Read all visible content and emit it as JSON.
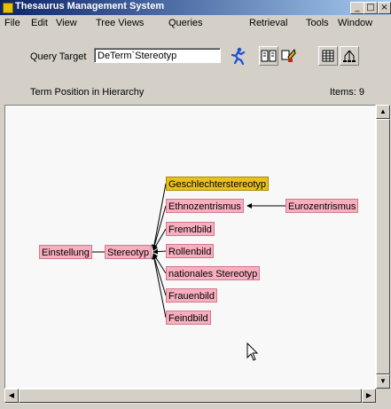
{
  "window": {
    "title": "Thesaurus Management System",
    "controls": [
      "_",
      "□",
      "×"
    ]
  },
  "menu": {
    "items": [
      {
        "label": "File"
      },
      {
        "label": "Edit"
      },
      {
        "label": "View"
      },
      {
        "label": "Tree Views"
      },
      {
        "label": "Queries"
      },
      {
        "label": "Retrieval"
      },
      {
        "label": "Tools"
      },
      {
        "label": "Window"
      }
    ]
  },
  "toolbar": {
    "query_target_label": "Query Target",
    "query_target_value": "DeTerm`Stereotyp",
    "icons": [
      "running-man-icon",
      "book-icon",
      "flag-icon",
      "grid-icon",
      "hierarchy-icon"
    ]
  },
  "status": {
    "label": "Term Position in Hierarchy",
    "items": "Items: 9"
  },
  "graph": {
    "nodes": [
      {
        "id": "einstellung",
        "label": "Einstellung"
      },
      {
        "id": "stereotyp",
        "label": "Stereotyp"
      },
      {
        "id": "geschlechterstereotyp",
        "label": "Geschlechterstereotyp",
        "selected": true
      },
      {
        "id": "ethnozentrismus",
        "label": "Ethnozentrismus"
      },
      {
        "id": "eurozentrismus",
        "label": "Eurozentrismus"
      },
      {
        "id": "fremdbild",
        "label": "Fremdbild"
      },
      {
        "id": "rollenbild",
        "label": "Rollenbild"
      },
      {
        "id": "nationales",
        "label": "nationales Stereotyp"
      },
      {
        "id": "frauenbild",
        "label": "Frauenbild"
      },
      {
        "id": "feindbild",
        "label": "Feindbild"
      }
    ]
  }
}
